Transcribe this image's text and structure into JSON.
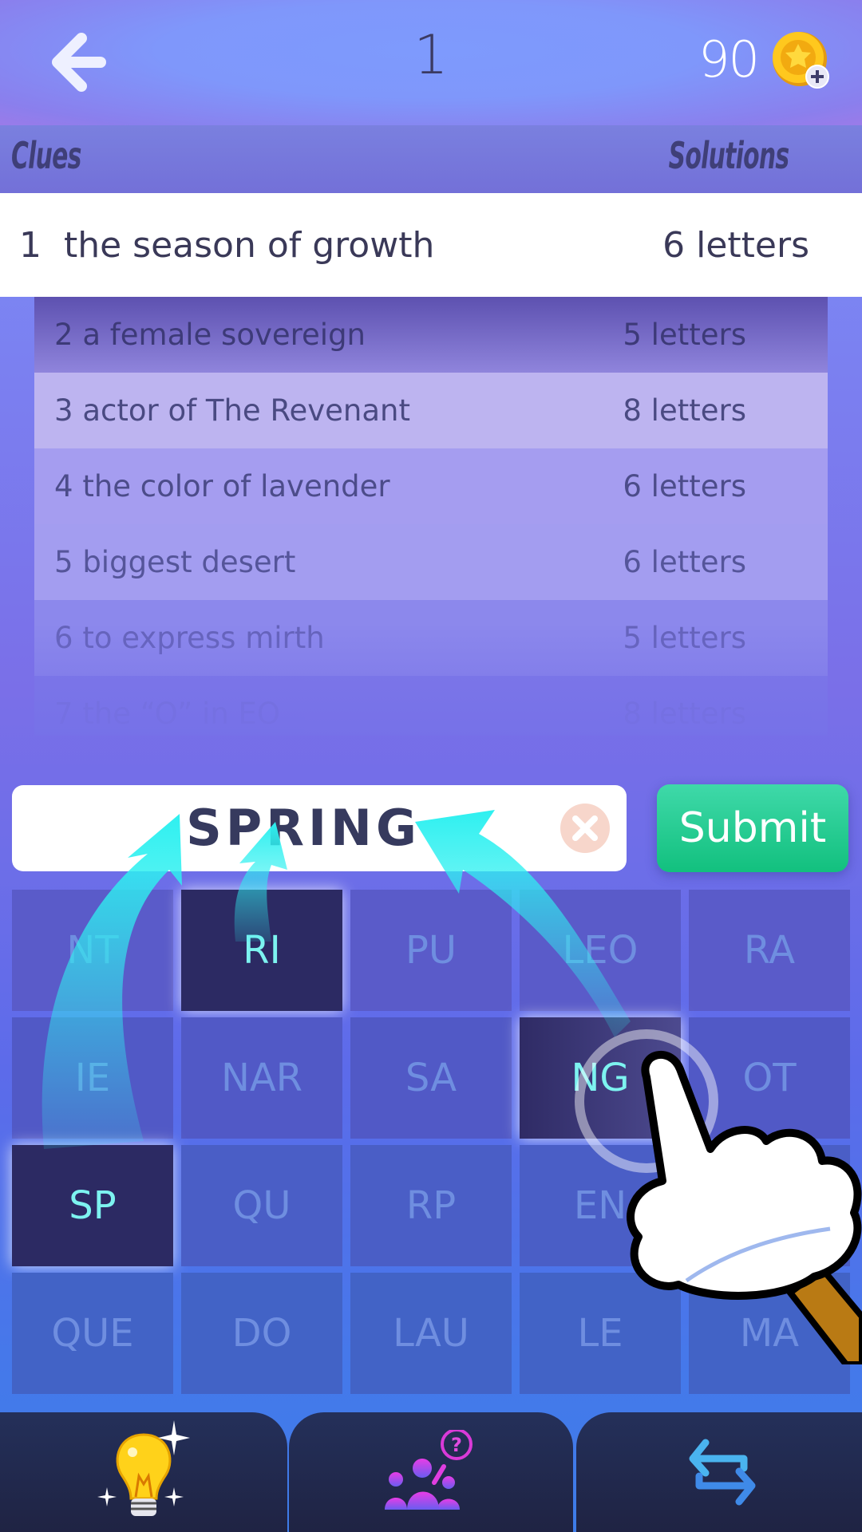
{
  "header": {
    "back_icon": "arrow-left-icon",
    "level": "1",
    "coins": "90",
    "coin_icon": "gold-star-coin-icon",
    "add_coins_icon": "plus-icon"
  },
  "columns": {
    "clues_label": "Clues",
    "solutions_label": "Solutions"
  },
  "active_clue": {
    "number": "1",
    "text": "the season of growth",
    "length": "6 letters"
  },
  "clues": [
    {
      "number": "2",
      "text": "a female sovereign",
      "length": "5 letters"
    },
    {
      "number": "3",
      "text": "actor of The Revenant",
      "length": "8 letters"
    },
    {
      "number": "4",
      "text": "the color of lavender",
      "length": "6 letters"
    },
    {
      "number": "5",
      "text": "biggest desert",
      "length": "6 letters"
    },
    {
      "number": "6",
      "text": "to express mirth",
      "length": "5 letters"
    },
    {
      "number": "7",
      "text": "the “O” in EO",
      "length": "8 letters"
    }
  ],
  "answer": {
    "value": "SPRING",
    "clear_icon": "close-circle-icon"
  },
  "submit_label": "Submit",
  "tiles": [
    [
      {
        "text": "NT",
        "selected": false
      },
      {
        "text": "RI",
        "selected": true
      },
      {
        "text": "PU",
        "selected": false
      },
      {
        "text": "LEO",
        "selected": false
      },
      {
        "text": "RA",
        "selected": false
      }
    ],
    [
      {
        "text": "IE",
        "selected": false
      },
      {
        "text": "NAR",
        "selected": false
      },
      {
        "text": "SA",
        "selected": false
      },
      {
        "text": "NG",
        "selected": true
      },
      {
        "text": "OT",
        "selected": false
      }
    ],
    [
      {
        "text": "SP",
        "selected": true
      },
      {
        "text": "QU",
        "selected": false
      },
      {
        "text": "RP",
        "selected": false
      },
      {
        "text": "EN",
        "selected": false
      },
      {
        "text": "",
        "selected": false
      }
    ],
    [
      {
        "text": "QUE",
        "selected": false
      },
      {
        "text": "DO",
        "selected": false
      },
      {
        "text": "LAU",
        "selected": false
      },
      {
        "text": "LE",
        "selected": false
      },
      {
        "text": "MA",
        "selected": false
      }
    ]
  ],
  "colors": {
    "selected_tile": "#2c2a63",
    "selected_text": "#7df3f0",
    "submit_green": "#12c07e",
    "arrow_cyan": "#2ef0f0"
  },
  "toolbar": {
    "hint_icon": "lightbulb-icon",
    "ask_friends_icon": "ask-friends-icon",
    "swap_icon": "swap-arrows-icon"
  }
}
